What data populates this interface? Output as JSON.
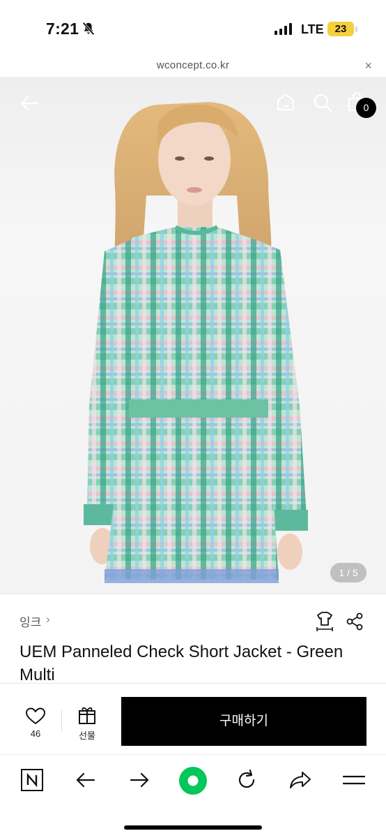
{
  "status_bar": {
    "time": "7:21",
    "network": "LTE",
    "battery": "23"
  },
  "url_bar": {
    "domain": "wconcept.co.kr",
    "close_label": "×"
  },
  "product_image": {
    "page_indicator": "1 / 5",
    "cart_count": "0"
  },
  "product": {
    "brand": "잉크",
    "brand_chevron": "›",
    "title": "UEM Panneled Check Short Jacket - Green Multi"
  },
  "actions": {
    "wish_count": "46",
    "gift_label": "선물",
    "buy_label": "구매하기"
  },
  "colors": {
    "accent_green": "#03c75a",
    "buy_button": "#000000",
    "battery": "#f4d03f"
  }
}
